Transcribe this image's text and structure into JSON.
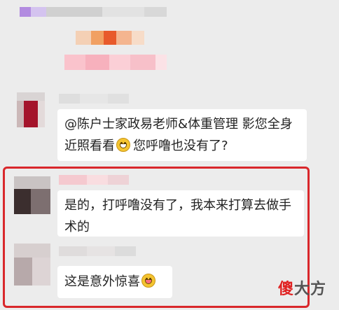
{
  "comments": [
    {
      "text_part1": "@陈户士家政易老师&体重管理 影您全身近照看看",
      "emoji": "grin-icon",
      "text_part2": "您呼噜也没有了?"
    },
    {
      "text": "是的，打呼噜没有了，我本来打算去做手术的"
    },
    {
      "text": "这是意外惊喜",
      "emoji": "tongue-wink-icon"
    }
  ],
  "watermark": {
    "part1": "傻",
    "part2": "大方"
  },
  "colors": {
    "highlight": "#d9272b",
    "bubble": "#ffffff",
    "background": "#ececec"
  }
}
